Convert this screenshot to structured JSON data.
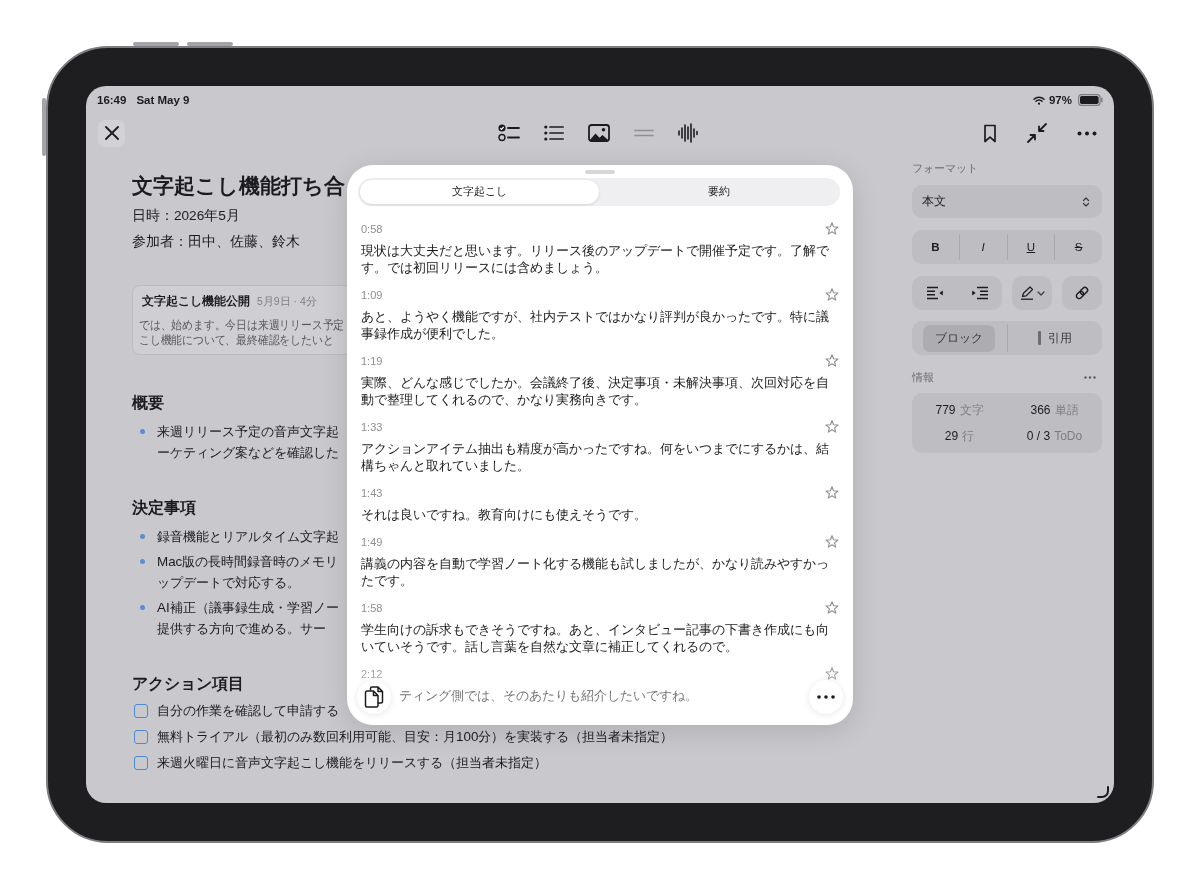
{
  "status_bar": {
    "time": "16:49",
    "date": "Sat May 9",
    "battery": "97%"
  },
  "toolbar": {
    "tools": [
      {
        "disabled": false
      },
      {
        "disabled": false
      },
      {
        "disabled": false
      },
      {
        "disabled": true
      },
      {
        "disabled": false
      }
    ]
  },
  "document": {
    "title": "文字起こし機能打ち合",
    "meta": [
      "日時：2026年5月",
      "参加者：田中、佐藤、鈴木"
    ],
    "recording": {
      "title": "文字起こし機能公開",
      "info": "5月9日 · 4分",
      "preview_lines": [
        "では、始めます。今日は来週リリース予定",
        "こし機能について、最終確認をしたいと"
      ]
    },
    "sections": [
      {
        "heading": "概要",
        "kind": "bullets",
        "items": [
          {
            "lines": [
              "来週リリース予定の音声文字起",
              "ーケティング案などを確認した"
            ]
          }
        ]
      },
      {
        "heading": "決定事項",
        "kind": "bullets",
        "items": [
          {
            "lines": [
              "録音機能とリアルタイム文字起"
            ]
          },
          {
            "lines": [
              "Mac版の長時間録音時のメモリ",
              "ップデートで対応する。"
            ]
          },
          {
            "lines": [
              "AI補正（議事録生成・学習ノー",
              "提供する方向で進める。サー"
            ]
          }
        ]
      },
      {
        "heading": "アクション項目",
        "kind": "todos",
        "items": [
          {
            "lines": [
              "自分の作業を確認して申請する"
            ],
            "checked": false
          },
          {
            "lines": [
              "無料トライアル（最初のみ数回利用可能、目安：月100分）を実装する（担当者未指定）"
            ],
            "checked": false
          },
          {
            "lines": [
              "来週火曜日に音声文字起こし機能をリリースする（担当者未指定）"
            ],
            "checked": false
          }
        ]
      }
    ]
  },
  "format_panel": {
    "label": "フォーマット",
    "style_select": {
      "value": "本文"
    },
    "text_styles": [
      {
        "kind": "bold",
        "label": "B",
        "selected": false
      },
      {
        "kind": "italic",
        "label": "I",
        "selected": false
      },
      {
        "kind": "underline",
        "label": "U",
        "selected": false
      },
      {
        "kind": "strikethrough",
        "label": "S",
        "selected": false
      }
    ],
    "paragraph_types": [
      {
        "kind": "block",
        "label": "ブロック",
        "selected": true
      },
      {
        "kind": "quote",
        "label": "引用",
        "selected": false
      }
    ],
    "info_label": "情報",
    "stats": [
      {
        "value": "779",
        "unit": "文字"
      },
      {
        "value": "366",
        "unit": "単語"
      },
      {
        "value": "29",
        "unit": "行"
      },
      {
        "value": "0 / 3",
        "unit": "ToDo"
      }
    ]
  },
  "transcript_sheet": {
    "tabs": [
      {
        "label": "文字起こし",
        "selected": true
      },
      {
        "label": "要約",
        "selected": false
      }
    ],
    "entries": [
      {
        "time": "0:58",
        "text": "現状は大丈夫だと思います。リリース後のアップデートで開催予定です。了解です。では初回リリースには含めましょう。",
        "starred": false
      },
      {
        "time": "1:09",
        "text": "あと、ようやく機能ですが、社内テストではかなり評判が良かったです。特に議事録作成が便利でした。",
        "starred": false
      },
      {
        "time": "1:19",
        "text": "実際、どんな感じでしたか。会議終了後、決定事項・未解決事項、次回対応を自動で整理してくれるので、かなり実務向きです。",
        "starred": false
      },
      {
        "time": "1:33",
        "text": "アクションアイテム抽出も精度が高かったですね。何をいつまでにするかは、結構ちゃんと取れていました。",
        "starred": false
      },
      {
        "time": "1:43",
        "text": "それは良いですね。教育向けにも使えそうです。",
        "starred": false
      },
      {
        "time": "1:49",
        "text": "講義の内容を自動で学習ノート化する機能も試しましたが、かなり読みやすかったです。",
        "starred": false
      },
      {
        "time": "1:58",
        "text": "学生向けの訴求もできそうですね。あと、インタビュー記事の下書き作成にも向いていそうです。話し言葉を自然な文章に補正してくれるので。",
        "starred": false
      },
      {
        "time": "2:12",
        "text": "ティング側では、そのあたりも紹介したいですね。",
        "starred": false
      }
    ]
  }
}
